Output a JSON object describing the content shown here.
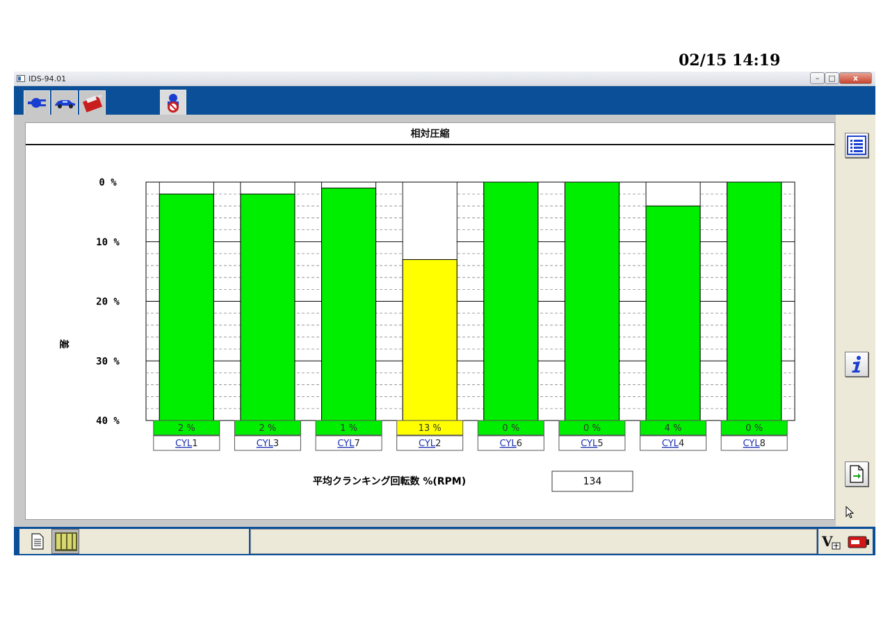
{
  "timestamp": "02/15 14:19",
  "window": {
    "title": "IDS-94.01",
    "controls": {
      "minimize": "–",
      "maximize": "□",
      "close": "x"
    }
  },
  "toolbar": {
    "tabs": [
      {
        "icon": "connector-icon"
      },
      {
        "icon": "vehicle-icon"
      },
      {
        "icon": "toolbox-icon"
      },
      {
        "icon": "technician-icon",
        "active": true
      }
    ]
  },
  "content": {
    "title": "相対圧縮",
    "y_axis_title": "差"
  },
  "chart_data": {
    "type": "bar",
    "title": "相対圧縮",
    "ylabel": "差",
    "ylim": [
      0,
      40
    ],
    "y_inverted": true,
    "y_ticks": [
      "0 %",
      "10 %",
      "20 %",
      "30 %",
      "40 %"
    ],
    "grid": true,
    "categories": [
      "CYL1",
      "CYL3",
      "CYL7",
      "CYL2",
      "CYL6",
      "CYL5",
      "CYL4",
      "CYL8"
    ],
    "category_prefix": "CYL",
    "category_numbers": [
      "1",
      "3",
      "7",
      "2",
      "6",
      "5",
      "4",
      "8"
    ],
    "values": [
      2,
      2,
      1,
      13,
      0,
      0,
      4,
      0
    ],
    "value_labels": [
      "2 %",
      "2 %",
      "1 %",
      "13 %",
      "0 %",
      "0 %",
      "4 %",
      "0 %"
    ],
    "bar_colors": [
      "#00ee00",
      "#00ee00",
      "#00ee00",
      "#ffff00",
      "#00ee00",
      "#00ee00",
      "#00ee00",
      "#00ee00"
    ],
    "colors": {
      "normal": "#00ee00",
      "warning": "#ffff00"
    }
  },
  "rpm": {
    "label": "平均クランキング回転数 %(RPM)",
    "value": "134"
  },
  "sidebar": {
    "buttons": [
      {
        "icon": "list-icon"
      },
      {
        "icon": "info-icon"
      },
      {
        "icon": "export-icon"
      }
    ]
  },
  "statusbar": {
    "left_icons": [
      "document-icon",
      "modules-icon"
    ],
    "right_icons": [
      "version-icon",
      "battery-icon"
    ]
  },
  "colors": {
    "toolbar_blue": "#0b4f99",
    "panel_beige": "#ece9d8"
  }
}
